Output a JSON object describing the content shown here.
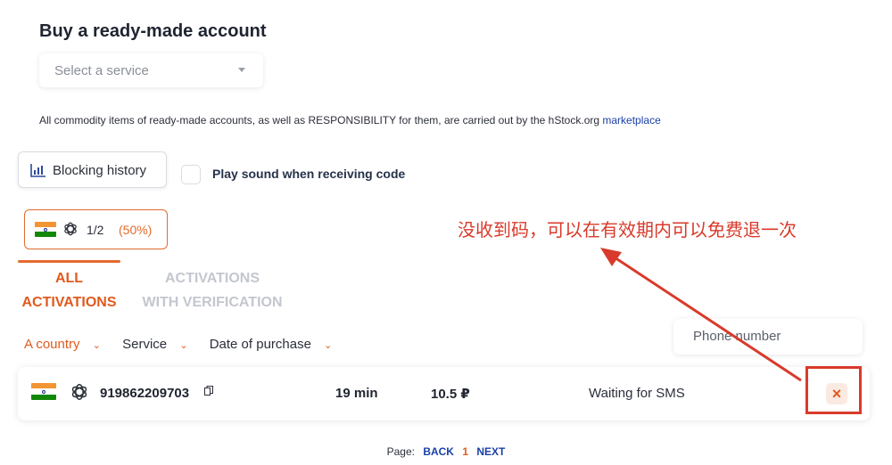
{
  "page": {
    "title": "Buy a ready-made account",
    "service_select": {
      "placeholder": "Select a service"
    },
    "notice": {
      "text": "All commodity items of ready-made accounts, as well as RESPONSIBILITY for them, are carried out by the hStock.org ",
      "link": "marketplace"
    },
    "blocking_history_label": "Blocking history",
    "play_sound_label": "Play sound when receiving code",
    "stats": {
      "ratio": "1/2",
      "percent": "(50%)"
    },
    "annotation": "没收到码，可以在有效期内可以免费退一次",
    "tabs": [
      {
        "line1": "ALL",
        "line2": "ACTIVATIONS"
      },
      {
        "line1": "ACTIVATIONS",
        "line2": "WITH VERIFICATION"
      }
    ],
    "filters": [
      "A country",
      "Service",
      "Date of purchase"
    ],
    "phone_search": {
      "placeholder": "Phone number"
    },
    "row": {
      "number": "919862209703",
      "time": "19 min",
      "price": "10.5 ₽",
      "status": "Waiting for SMS",
      "cancel_symbol": "×"
    },
    "pager": {
      "label": "Page:",
      "back": "BACK",
      "current": "1",
      "next": "NEXT"
    }
  },
  "colors": {
    "accent": "#e05a1e",
    "link": "#1a3fa8",
    "annotation": "#d93a2b"
  },
  "icons": [
    "india-flag-icon",
    "openai-icon",
    "bar-chart-icon",
    "copy-icon",
    "close-icon",
    "chevron-down-icon"
  ]
}
